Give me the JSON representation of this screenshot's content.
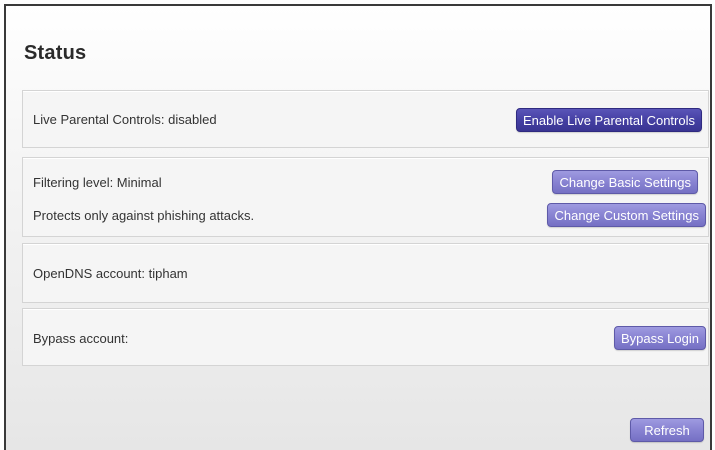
{
  "page": {
    "title": "Status"
  },
  "parental_controls": {
    "status_text": "Live Parental Controls: disabled",
    "enable_button": "Enable Live Parental Controls"
  },
  "filtering": {
    "level_text": "Filtering level: Minimal",
    "description": "Protects only against phishing attacks.",
    "basic_button": "Change Basic Settings",
    "custom_button": "Change Custom Settings"
  },
  "account": {
    "opendns_text": "OpenDNS account: tipham"
  },
  "bypass": {
    "label": "Bypass account:",
    "login_button": "Bypass Login"
  },
  "footer": {
    "refresh_button": "Refresh"
  },
  "colors": {
    "primary_button": "#4540a3",
    "secondary_button": "#8883d2"
  }
}
